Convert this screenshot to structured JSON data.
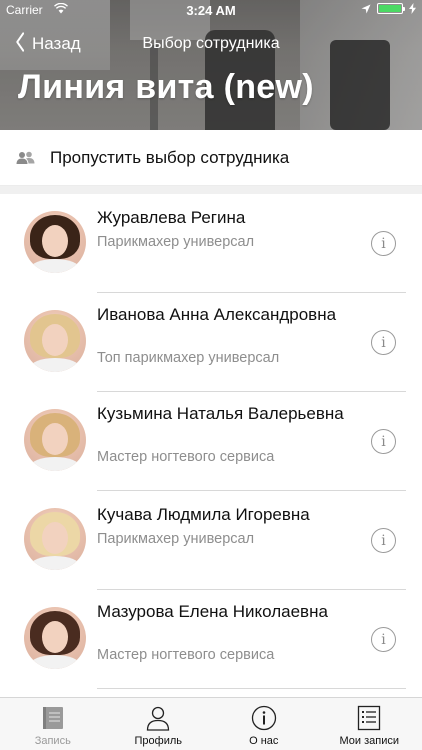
{
  "status_bar": {
    "carrier": "Carrier",
    "time": "3:24 AM"
  },
  "nav": {
    "back_label": "Назад",
    "title": "Выбор сотрудника"
  },
  "salon": {
    "name": "Линия вита (new)"
  },
  "skip": {
    "label": "Пропустить выбор сотрудника",
    "icon": "group-icon"
  },
  "employees": [
    {
      "name": "Журавлева Регина",
      "role": "Парикмахер универсал",
      "hair_color": "#3a2418"
    },
    {
      "name": "Иванова Анна Александровна",
      "role": "Топ парикмахер универсал",
      "hair_color": "#e2c58f"
    },
    {
      "name": "Кузьмина Наталья Валерьевна",
      "role": "Мастер ногтевого сервиса",
      "hair_color": "#d9b27a"
    },
    {
      "name": "Кучава Людмила Игоревна",
      "role": "Парикмахер универсал",
      "hair_color": "#ecd7a6"
    },
    {
      "name": "Мазурова Елена Николаевна",
      "role": "Мастер ногтевого сервиса",
      "hair_color": "#4a2c20"
    }
  ],
  "tabbar": {
    "tabs": [
      {
        "label": "Запись",
        "icon": "book-icon",
        "active": true
      },
      {
        "label": "Профиль",
        "icon": "person-icon",
        "active": false
      },
      {
        "label": "О нас",
        "icon": "info-icon",
        "active": false
      },
      {
        "label": "Мои записи",
        "icon": "list-icon",
        "active": false
      }
    ]
  },
  "colors": {
    "battery": "#4cd964",
    "secondary_text": "#8e8e8e",
    "tab_active": "#9a9a9a"
  }
}
